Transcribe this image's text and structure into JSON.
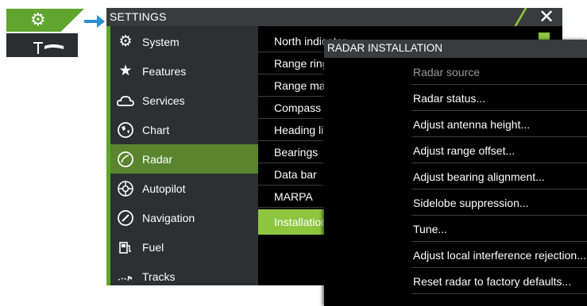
{
  "launcher": {
    "settings_icon": "gear-icon",
    "radar_icon": "radar-antenna-icon",
    "accent": "#5fa52e"
  },
  "window": {
    "title": "SETTINGS",
    "close_label": "✕"
  },
  "sidebar": {
    "items": [
      {
        "label": "System",
        "icon": "gear-icon"
      },
      {
        "label": "Features",
        "icon": "star-icon"
      },
      {
        "label": "Services",
        "icon": "cloud-icon"
      },
      {
        "label": "Chart",
        "icon": "globe-icon"
      },
      {
        "label": "Radar",
        "icon": "radar-icon",
        "selected": true
      },
      {
        "label": "Autopilot",
        "icon": "steering-wheel-icon"
      },
      {
        "label": "Navigation",
        "icon": "compass-icon"
      },
      {
        "label": "Fuel",
        "icon": "fuel-pump-icon"
      },
      {
        "label": "Tracks",
        "icon": "tracks-icon"
      }
    ]
  },
  "radar_menu": {
    "items": [
      {
        "label": "North indicator"
      },
      {
        "label": "Range rings"
      },
      {
        "label": "Range markers"
      },
      {
        "label": "Compass"
      },
      {
        "label": "Heading line"
      },
      {
        "label": "Bearings"
      },
      {
        "label": "Data bar"
      },
      {
        "label": "MARPA"
      },
      {
        "label": "Installation",
        "selected": true
      }
    ]
  },
  "popup": {
    "title": "RADAR INSTALLATION",
    "items": [
      {
        "label": "Radar source",
        "disabled": true
      },
      {
        "label": "Radar status..."
      },
      {
        "label": "Adjust antenna height..."
      },
      {
        "label": "Adjust range offset..."
      },
      {
        "label": "Adjust bearing alignment..."
      },
      {
        "label": "Sidelobe suppression..."
      },
      {
        "label": "Tune..."
      },
      {
        "label": "Adjust local interference rejection..."
      },
      {
        "label": "Reset radar to factory defaults..."
      }
    ]
  }
}
